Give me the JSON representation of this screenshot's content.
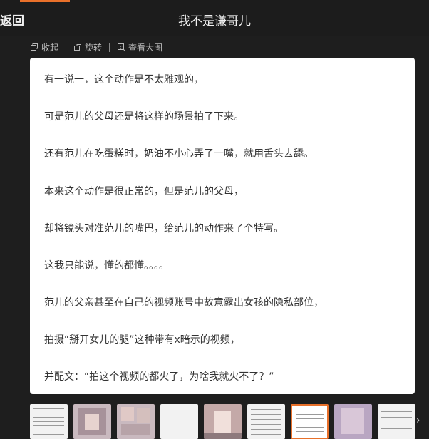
{
  "header": {
    "back_label": "返回",
    "title": "我不是谦哥儿"
  },
  "toolbar": {
    "collapse_label": "收起",
    "rotate_label": "旋转",
    "view_large_label": "查看大图"
  },
  "article": {
    "paragraphs": [
      "有一说一，这个动作是不太雅观的，",
      "可是范儿的父母还是将这样的场景拍了下来。",
      "还有范儿在吃蛋糕时，奶油不小心弄了一嘴，就用舌头去舔。",
      "本来这个动作是很正常的，但是范儿的父母，",
      "却将镜头对准范儿的嘴巴，给范儿的动作来了个特写。",
      "这我只能说，懂的都懂。。。。",
      "范儿的父亲甚至在自己的视频账号中故意露出女孩的隐私部位，",
      "拍摄“掰开女儿的腿”这种带有x暗示的视频，",
      "并配文：“拍这个视频的都火了，为啥我就火不了？”"
    ]
  },
  "thumbnails": {
    "count": 10,
    "active_index": 6
  },
  "colors": {
    "accent": "#e8702a",
    "background": "#1e1e1e",
    "card": "#ffffff"
  }
}
